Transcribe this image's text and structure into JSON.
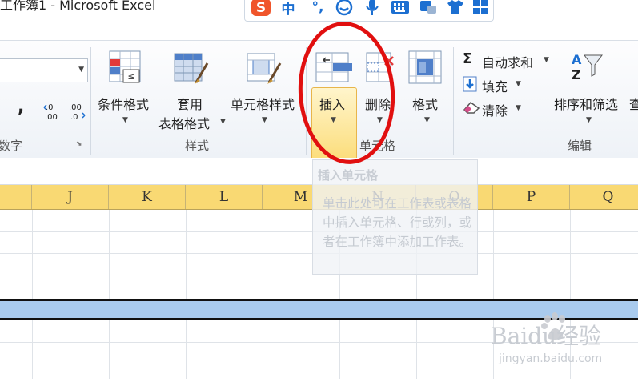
{
  "window": {
    "title": "工作簿1 - Microsoft Excel"
  },
  "ime_toolbar": {
    "logo": "S",
    "mode": "中",
    "icons": [
      "punctuation-icon",
      "emoji-icon",
      "microphone-icon",
      "keyboard-icon",
      "skin-icon",
      "shirt-icon",
      "grid-apps-icon"
    ]
  },
  "ribbon": {
    "number_group": {
      "label": "数字",
      "comma": ",",
      "increase_decimal": "←.0\n.00",
      "decrease_decimal": ".00\n→.0"
    },
    "styles_group": {
      "label": "样式",
      "conditional_format": "条件格式",
      "table_format_line1": "套用",
      "table_format_line2": "表格格式",
      "cell_styles": "单元格样式"
    },
    "cells_group": {
      "label": "单元格",
      "insert": "插入",
      "delete": "删除",
      "format": "格式"
    },
    "editing_group": {
      "label": "编辑",
      "autosum": "自动求和",
      "fill": "填充",
      "clear": "清除",
      "sort_filter": "排序和筛选",
      "find": "查"
    }
  },
  "columns": [
    "J",
    "K",
    "L",
    "M",
    "N",
    "O",
    "P",
    "Q"
  ],
  "tooltip": {
    "title": "插入单元格",
    "body": "单击此处可在工作表或表格中插入单元格、行或列，或者在工作簿中添加工作表。"
  },
  "watermark": {
    "brand": "Baidu经验",
    "url": "jingyan.baidu.com"
  },
  "colors": {
    "highlight": "#e10f0f",
    "selected_row": "#a9cbee",
    "column_header": "#f9d973"
  }
}
